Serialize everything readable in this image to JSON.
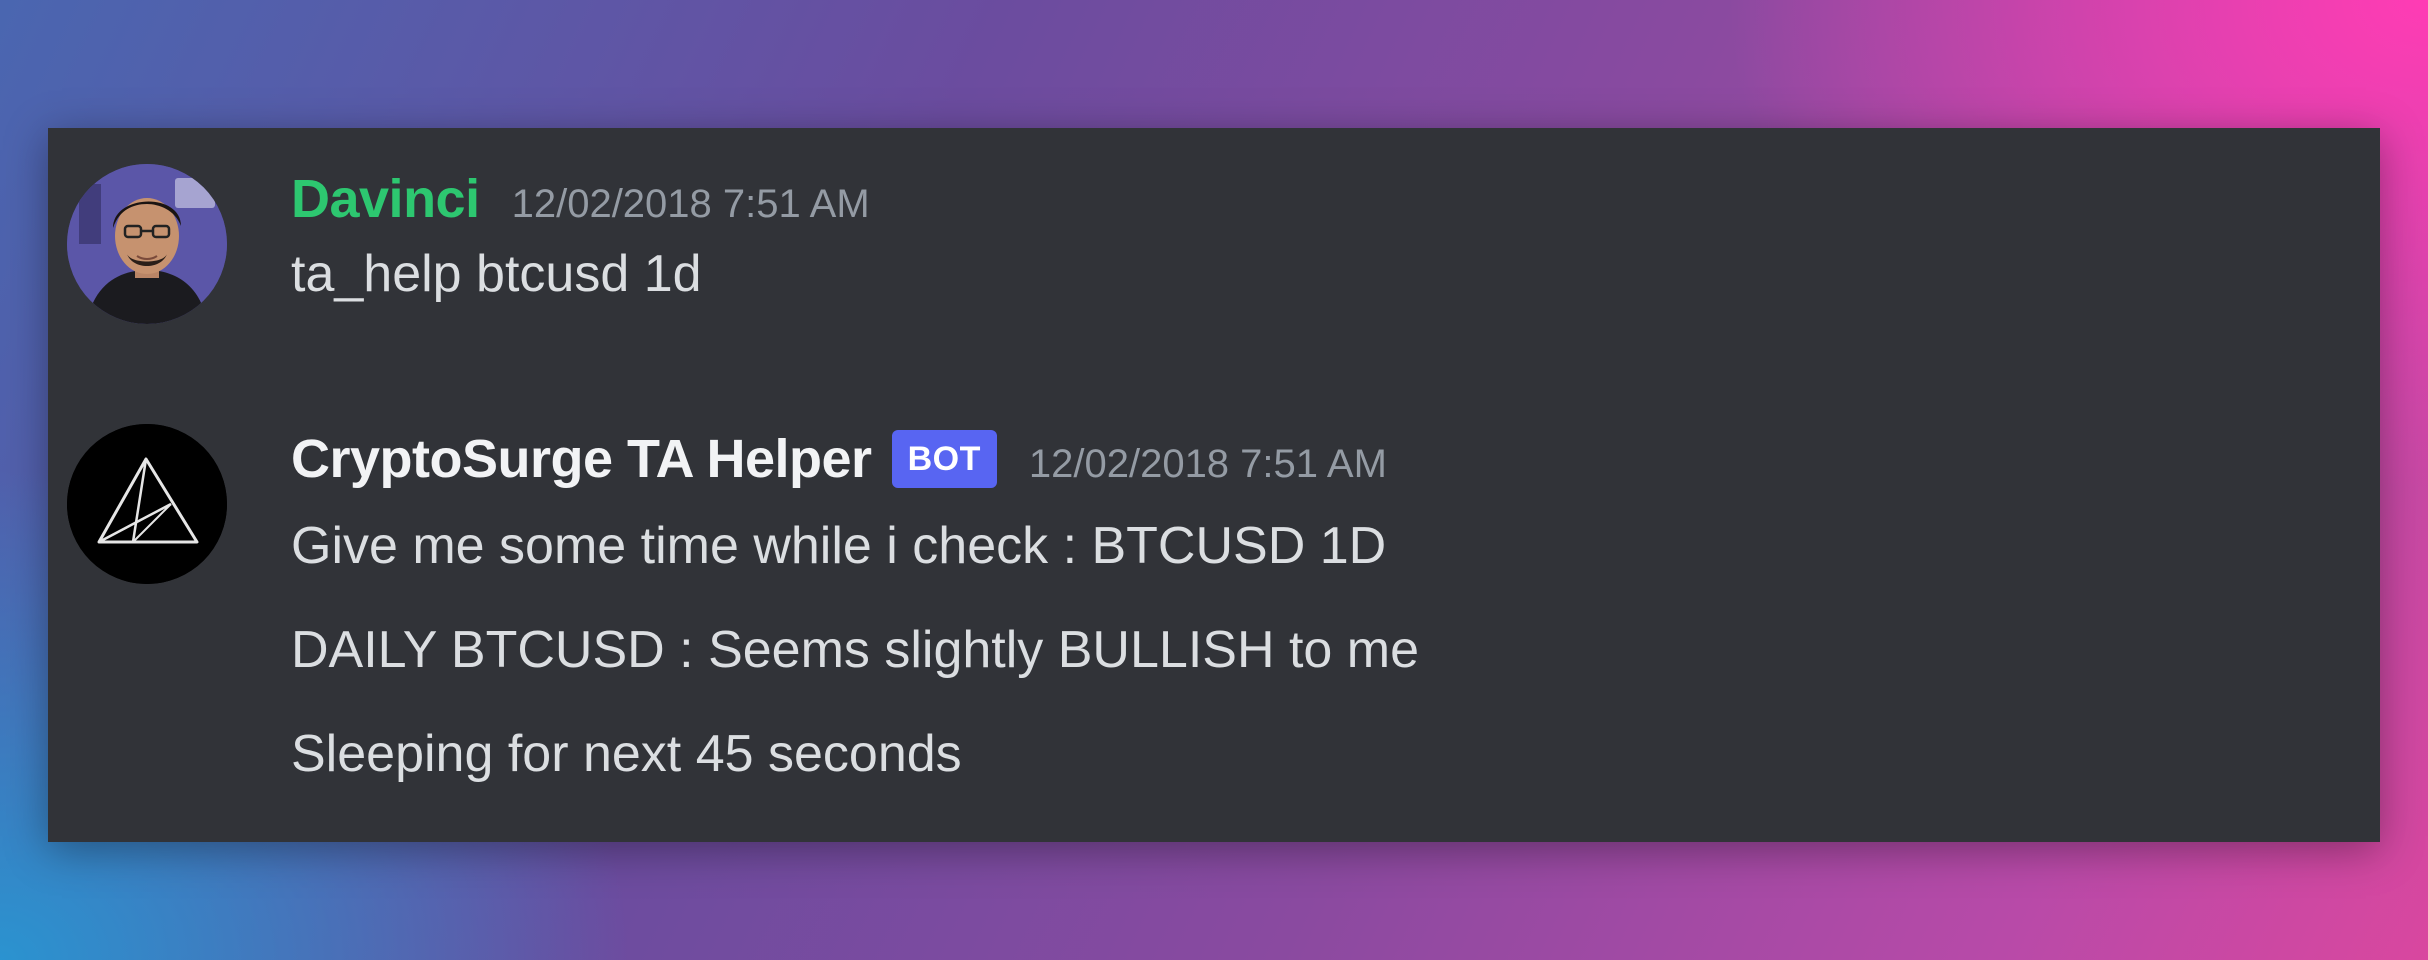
{
  "messages": [
    {
      "username": "Davinci",
      "username_color": "#2dc770",
      "timestamp": "12/02/2018 7:51 AM",
      "avatar": "user-photo-avatar",
      "lines": [
        "ta_help btcusd 1d"
      ]
    },
    {
      "username": "CryptoSurge TA Helper",
      "username_color": "#f2f3f5",
      "badge": "BOT",
      "badge_color": "#5865f2",
      "timestamp": "12/02/2018 7:51 AM",
      "avatar": "bot-triangle-logo-avatar",
      "lines": [
        "Give me some time while i check : BTCUSD 1D",
        "DAILY BTCUSD : Seems slightly BULLISH to me",
        "Sleeping for next 45 seconds"
      ]
    }
  ],
  "colors": {
    "panel_background": "#313338",
    "message_text": "#dbdee1",
    "timestamp_text": "#949ba4"
  }
}
